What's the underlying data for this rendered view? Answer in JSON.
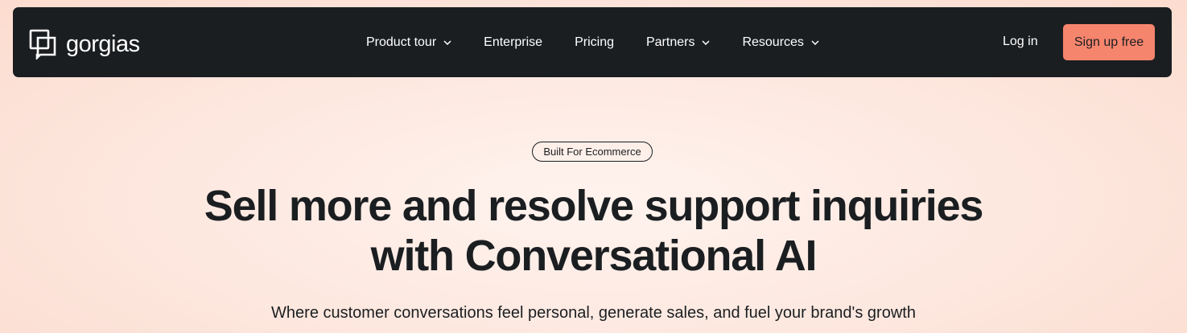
{
  "brand": {
    "name": "gorgias",
    "logo_icon": "chat-bubbles-icon"
  },
  "nav": {
    "items": [
      {
        "label": "Product tour",
        "has_dropdown": true
      },
      {
        "label": "Enterprise",
        "has_dropdown": false
      },
      {
        "label": "Pricing",
        "has_dropdown": false
      },
      {
        "label": "Partners",
        "has_dropdown": true
      },
      {
        "label": "Resources",
        "has_dropdown": true
      }
    ],
    "login_label": "Log in",
    "signup_label": "Sign up free"
  },
  "hero": {
    "badge": "Built For Ecommerce",
    "headline_line1": "Sell more and resolve support inquiries",
    "headline_line2": "with Conversational AI",
    "subtext": "Where customer conversations feel personal, generate sales, and fuel your brand's growth"
  },
  "colors": {
    "navbar_bg": "#1b1e21",
    "cta_bg": "#f6856d",
    "page_bg": "#fde9e1",
    "text": "#1b1e21"
  }
}
